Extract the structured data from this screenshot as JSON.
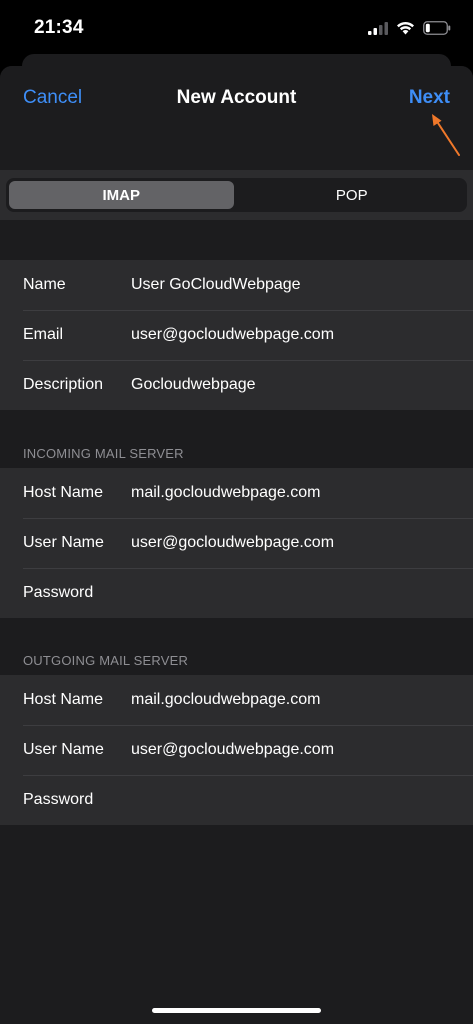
{
  "status": {
    "time": "21:34",
    "icons": [
      "signal-icon",
      "wifi-icon",
      "battery-icon"
    ]
  },
  "nav": {
    "cancel": "Cancel",
    "title": "New Account",
    "next": "Next"
  },
  "segments": {
    "options": [
      "IMAP",
      "POP"
    ],
    "selected": "IMAP"
  },
  "account": {
    "rows": [
      {
        "label": "Name",
        "value": "User GoCloudWebpage"
      },
      {
        "label": "Email",
        "value": "user@gocloudwebpage.com"
      },
      {
        "label": "Description",
        "value": "Gocloudwebpage"
      }
    ]
  },
  "incoming": {
    "header": "INCOMING MAIL SERVER",
    "rows": [
      {
        "label": "Host Name",
        "value": "mail.gocloudwebpage.com"
      },
      {
        "label": "User Name",
        "value": "user@gocloudwebpage.com"
      },
      {
        "label": "Password",
        "value": ""
      }
    ]
  },
  "outgoing": {
    "header": "OUTGOING MAIL SERVER",
    "rows": [
      {
        "label": "Host Name",
        "value": "mail.gocloudwebpage.com"
      },
      {
        "label": "User Name",
        "value": "user@gocloudwebpage.com"
      },
      {
        "label": "Password",
        "value": ""
      }
    ]
  },
  "colors": {
    "accent": "#3e8ef7",
    "annotation_arrow": "#f0782a"
  }
}
